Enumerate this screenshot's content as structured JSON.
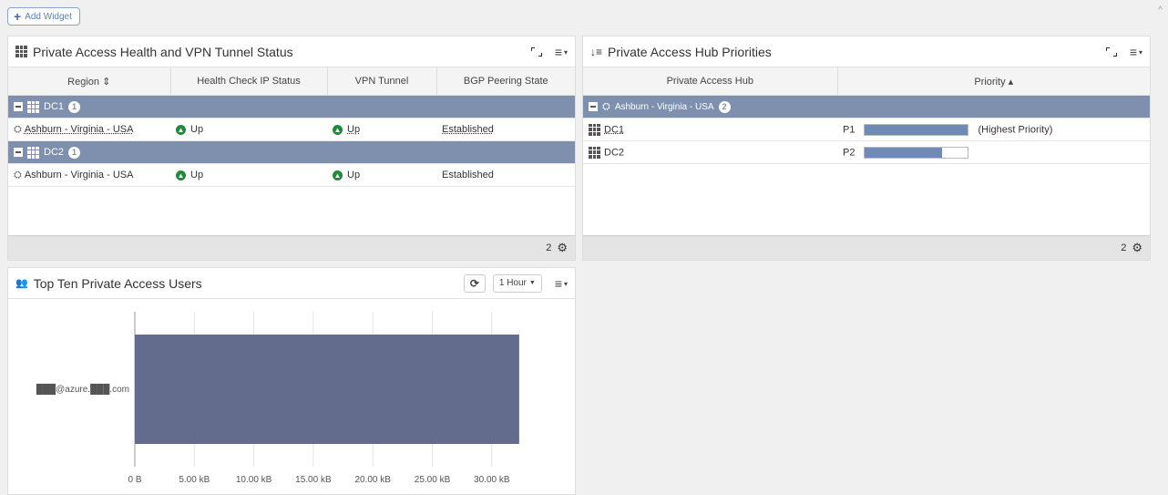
{
  "toolbar": {
    "add_widget_label": "Add Widget"
  },
  "widget_health": {
    "title": "Private Access Health and VPN Tunnel Status",
    "columns": [
      "Region ⇕",
      "Health Check IP Status",
      "VPN Tunnel",
      "BGP Peering State"
    ],
    "groups": [
      {
        "name": "DC1",
        "count": "1",
        "row": {
          "region": "Ashburn - Virginia - USA",
          "health": "Up",
          "vpn": "Up",
          "bgp": "Established"
        }
      },
      {
        "name": "DC2",
        "count": "1",
        "row": {
          "region": "Ashburn - Virginia - USA",
          "health": "Up",
          "vpn": "Up",
          "bgp": "Established"
        }
      }
    ],
    "footer_count": "2"
  },
  "widget_priorities": {
    "title": "Private Access Hub Priorities",
    "columns": [
      "Private Access Hub",
      "Priority ▴"
    ],
    "group": {
      "name": "Ashburn - Virginia - USA",
      "count": "2"
    },
    "rows": [
      {
        "hub": "DC1",
        "priority": "P1",
        "note": "(Highest Priority)",
        "fill": 1.0
      },
      {
        "hub": "DC2",
        "priority": "P2",
        "note": "",
        "fill": 0.75
      }
    ],
    "footer_count": "2"
  },
  "widget_users": {
    "title": "Top Ten Private Access Users",
    "time_range": "1 Hour"
  },
  "chart_data": {
    "type": "bar",
    "orientation": "horizontal",
    "categories": [
      "███@azure.███.com"
    ],
    "values": [
      32.3
    ],
    "unit": "kB",
    "xlim": [
      0,
      33
    ],
    "xticks": [
      "0 B",
      "5.00 kB",
      "10.00 kB",
      "15.00 kB",
      "20.00 kB",
      "25.00 kB",
      "30.00 kB"
    ],
    "bar_color": "#636c8c",
    "grid": true
  },
  "colors": {
    "group_row": "#7e90ad",
    "status_up": "#1f8b3a",
    "priority_fill": "#6f8ab5"
  }
}
